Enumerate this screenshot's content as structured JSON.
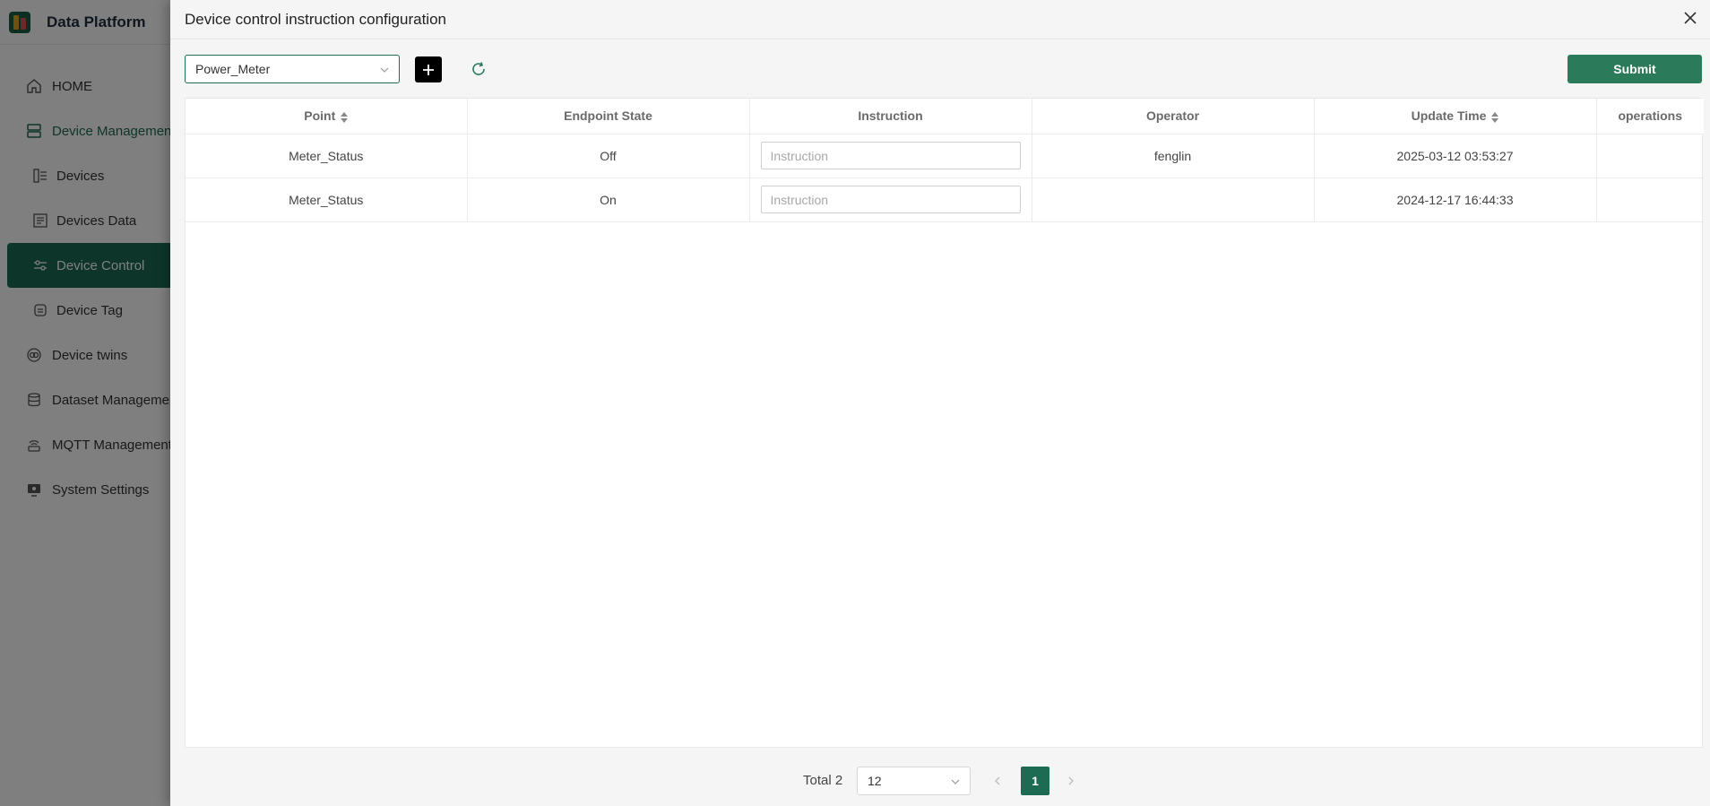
{
  "app": {
    "brand": "Data Platform",
    "nav": [
      {
        "id": "home",
        "label": "HOME",
        "icon": "home-icon"
      },
      {
        "id": "device-management",
        "label": "Device Management",
        "icon": "server-icon"
      },
      {
        "id": "devices",
        "label": "Devices",
        "icon": "device-list-icon"
      },
      {
        "id": "devices-data",
        "label": "Devices Data",
        "icon": "data-sheet-icon"
      },
      {
        "id": "device-control",
        "label": "Device Control",
        "icon": "sliders-icon"
      },
      {
        "id": "device-tag",
        "label": "Device Tag",
        "icon": "tag-icon"
      },
      {
        "id": "device-twins",
        "label": "Device twins",
        "icon": "twin-icon"
      },
      {
        "id": "dataset-management",
        "label": "Dataset Management",
        "icon": "database-icon"
      },
      {
        "id": "mqtt-management",
        "label": "MQTT Management",
        "icon": "broadcast-icon"
      },
      {
        "id": "system-settings",
        "label": "System Settings",
        "icon": "monitor-icon"
      }
    ]
  },
  "drawer": {
    "title": "Device control instruction configuration",
    "device_select_value": "Power_Meter",
    "submit_label": "Submit"
  },
  "table": {
    "columns": [
      "Point",
      "Endpoint State",
      "Instruction",
      "Operator",
      "Update Time",
      "operations"
    ],
    "instruction_placeholder": "Instruction",
    "rows": [
      {
        "point": "Meter_Status",
        "endpoint_state": "Off",
        "instruction": "",
        "operator": "fenglin",
        "update_time": "2025-03-12 03:53:27",
        "operations": ""
      },
      {
        "point": "Meter_Status",
        "endpoint_state": "On",
        "instruction": "",
        "operator": "",
        "update_time": "2024-12-17 16:44:33",
        "operations": ""
      }
    ]
  },
  "pagination": {
    "total_label": "Total 2",
    "page_size": "12",
    "current_page": "1"
  },
  "colors": {
    "accent": "#1d6b52",
    "submit": "#2b7b5a",
    "mask": "rgba(0,0,0,0.5)"
  }
}
